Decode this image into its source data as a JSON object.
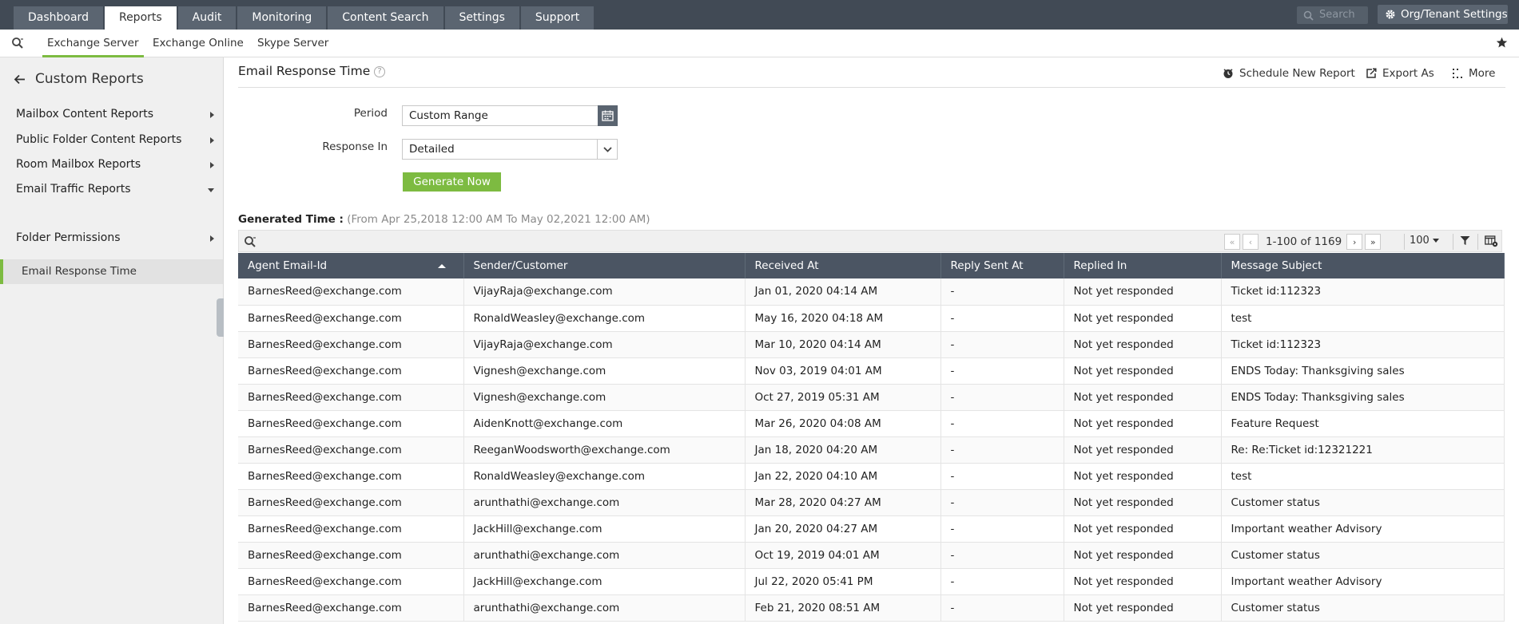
{
  "top_nav": {
    "tabs": [
      {
        "label": "Dashboard",
        "active": false
      },
      {
        "label": "Reports",
        "active": true
      },
      {
        "label": "Audit",
        "active": false
      },
      {
        "label": "Monitoring",
        "active": false
      },
      {
        "label": "Content Search",
        "active": false
      },
      {
        "label": "Settings",
        "active": false
      },
      {
        "label": "Support",
        "active": false
      }
    ],
    "search_placeholder": "Search",
    "org_settings_label": "Org/Tenant Settings"
  },
  "sub_nav": {
    "tabs": [
      "Exchange Server",
      "Exchange Online",
      "Skype Server"
    ],
    "active_tab": "Exchange Server"
  },
  "sidebar": {
    "header": "Custom Reports",
    "items": [
      {
        "label": "Mailbox Content Reports",
        "expanded": false
      },
      {
        "label": "Public Folder Content Reports",
        "expanded": false
      },
      {
        "label": "Room Mailbox Reports",
        "expanded": false
      },
      {
        "label": "Email Traffic Reports",
        "expanded": true
      },
      {
        "label": "Folder Permissions",
        "expanded": false
      }
    ],
    "selected_sub_item": "Email Response Time"
  },
  "page": {
    "title": "Email Response Time",
    "help_symbol": "?",
    "actions": {
      "schedule": "Schedule New Report",
      "export": "Export As",
      "more": "More"
    }
  },
  "form": {
    "period_label": "Period",
    "period_value": "Custom Range",
    "response_label": "Response In",
    "response_value": "Detailed",
    "generate_label": "Generate Now"
  },
  "generated": {
    "label": "Generated Time :",
    "range": "(From Apr 25,2018 12:00 AM To May 02,2021 12:00 AM)"
  },
  "grid_toolbar": {
    "pager_text": "1-100 of 1169",
    "page_size": "100"
  },
  "table": {
    "columns": [
      "Agent Email-Id",
      "Sender/Customer",
      "Received At",
      "Reply Sent At",
      "Replied In",
      "Message Subject"
    ],
    "sorted_column": "Agent Email-Id",
    "sort_direction": "ascending",
    "rows": [
      [
        "BarnesReed@exchange.com",
        "VijayRaja@exchange.com",
        "Jan 01, 2020 04:14 AM",
        "-",
        "Not yet responded",
        "Ticket id:112323"
      ],
      [
        "BarnesReed@exchange.com",
        "RonaldWeasley@exchange.com",
        "May 16, 2020 04:18 AM",
        "-",
        "Not yet responded",
        "test"
      ],
      [
        "BarnesReed@exchange.com",
        "VijayRaja@exchange.com",
        "Mar 10, 2020 04:14 AM",
        "-",
        "Not yet responded",
        "Ticket id:112323"
      ],
      [
        "BarnesReed@exchange.com",
        "Vignesh@exchange.com",
        "Nov 03, 2019 04:01 AM",
        "-",
        "Not yet responded",
        "ENDS Today: Thanksgiving sales"
      ],
      [
        "BarnesReed@exchange.com",
        "Vignesh@exchange.com",
        "Oct 27, 2019 05:31 AM",
        "-",
        "Not yet responded",
        "ENDS Today: Thanksgiving sales"
      ],
      [
        "BarnesReed@exchange.com",
        "AidenKnott@exchange.com",
        "Mar 26, 2020 04:08 AM",
        "-",
        "Not yet responded",
        "Feature Request"
      ],
      [
        "BarnesReed@exchange.com",
        "ReeganWoodsworth@exchange.com",
        "Jan 18, 2020 04:20 AM",
        "-",
        "Not yet responded",
        "Re: Re:Ticket id:12321221"
      ],
      [
        "BarnesReed@exchange.com",
        "RonaldWeasley@exchange.com",
        "Jan 22, 2020 04:10 AM",
        "-",
        "Not yet responded",
        "test"
      ],
      [
        "BarnesReed@exchange.com",
        "arunthathi@exchange.com",
        "Mar 28, 2020 04:27 AM",
        "-",
        "Not yet responded",
        "Customer status"
      ],
      [
        "BarnesReed@exchange.com",
        "JackHill@exchange.com",
        "Jan 20, 2020 04:27 AM",
        "-",
        "Not yet responded",
        "Important weather Advisory"
      ],
      [
        "BarnesReed@exchange.com",
        "arunthathi@exchange.com",
        "Oct 19, 2019 04:01 AM",
        "-",
        "Not yet responded",
        "Customer status"
      ],
      [
        "BarnesReed@exchange.com",
        "JackHill@exchange.com",
        "Jul 22, 2020 05:41 PM",
        "-",
        "Not yet responded",
        "Important weather Advisory"
      ],
      [
        "BarnesReed@exchange.com",
        "arunthathi@exchange.com",
        "Feb 21, 2020 08:51 AM",
        "-",
        "Not yet responded",
        "Customer status"
      ]
    ]
  },
  "colors": {
    "topbar": "#414a55",
    "accent_green": "#7dbb41",
    "table_header": "#4b5563",
    "sidebar_bg": "#f0f0f0"
  },
  "icons": [
    "search-icon",
    "gear-icon",
    "star-icon",
    "back-arrow-icon",
    "help-icon",
    "schedule-icon",
    "export-icon",
    "more-icon",
    "calendar-icon",
    "chevron-down-icon",
    "first-page-icon",
    "prev-page-icon",
    "next-page-icon",
    "last-page-icon",
    "filter-icon",
    "column-chooser-icon"
  ]
}
